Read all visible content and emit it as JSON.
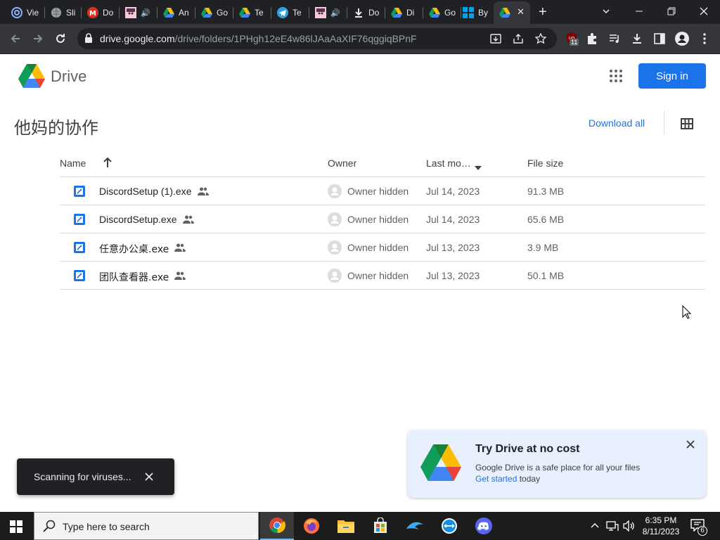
{
  "browser": {
    "tabs": [
      {
        "label": "Vie",
        "icon": "at-sign-icon"
      },
      {
        "label": "Sli",
        "icon": "globe-icon"
      },
      {
        "label": "Do",
        "icon": "m-logo-icon"
      },
      {
        "label": "",
        "icon": "anime-avatar-icon",
        "audio": true
      },
      {
        "label": "An",
        "icon": "google-drive-icon"
      },
      {
        "label": "Go",
        "icon": "google-drive-icon"
      },
      {
        "label": "Te",
        "icon": "google-drive-icon"
      },
      {
        "label": "Te",
        "icon": "telegram-icon"
      },
      {
        "label": "",
        "icon": "anime-avatar-icon",
        "audio": true
      },
      {
        "label": "Do",
        "icon": "download-icon"
      },
      {
        "label": "Di",
        "icon": "google-drive-icon"
      },
      {
        "label": "Go",
        "icon": "google-drive-icon"
      },
      {
        "label": "By",
        "icon": "windows-icon"
      },
      {
        "label": "",
        "icon": "google-drive-icon",
        "active": true
      }
    ],
    "url_host": "drive.google.com",
    "url_path": "/drive/folders/1PHgh12eE4w86lJAaAaXIF76qggiqBPnF",
    "extension_badge": "11"
  },
  "drive": {
    "app_name": "Drive",
    "sign_in_label": "Sign in",
    "folder_title": "他妈的协作",
    "download_all_label": "Download all",
    "columns": {
      "name": "Name",
      "owner": "Owner",
      "modified": "Last mo…",
      "size": "File size"
    },
    "files": [
      {
        "name": "DiscordSetup (1).exe",
        "owner": "Owner hidden",
        "modified": "Jul 14, 2023",
        "size": "91.3 MB"
      },
      {
        "name": "DiscordSetup.exe",
        "owner": "Owner hidden",
        "modified": "Jul 14, 2023",
        "size": "65.6 MB"
      },
      {
        "name": "任意办公桌.exe",
        "owner": "Owner hidden",
        "modified": "Jul 13, 2023",
        "size": "3.9 MB"
      },
      {
        "name": "团队查看器.exe",
        "owner": "Owner hidden",
        "modified": "Jul 13, 2023",
        "size": "50.1 MB"
      }
    ]
  },
  "toast": {
    "text": "Scanning for viruses..."
  },
  "promo": {
    "title": "Try Drive at no cost",
    "body": "Google Drive is a safe place for all your files",
    "link": "Get started",
    "link_suffix": " today"
  },
  "taskbar": {
    "search_placeholder": "Type here to search",
    "time": "6:35 PM",
    "date": "8/11/2023",
    "notification_count": "6"
  },
  "colors": {
    "accent": "#1a73e8",
    "chrome_dark": "#202124",
    "chrome_toolbar": "#35363a",
    "promo_bg": "#e8f0fe"
  }
}
